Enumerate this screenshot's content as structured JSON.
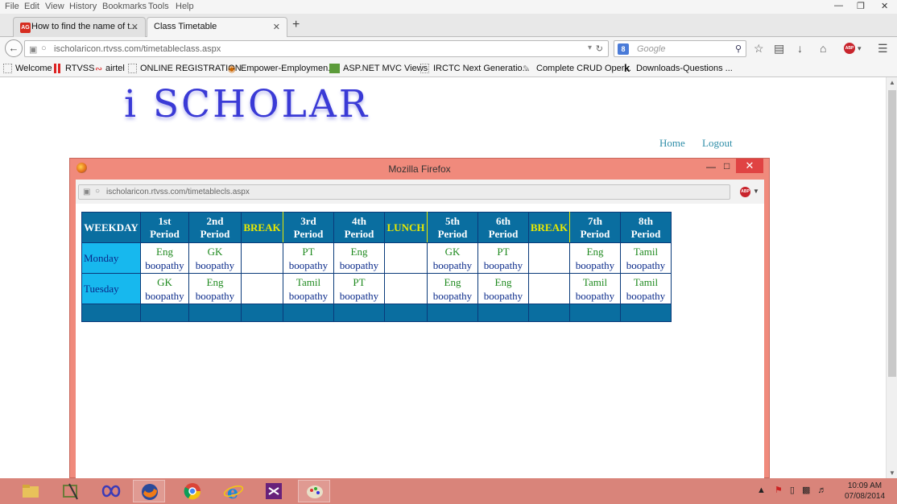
{
  "browser": {
    "menu": [
      "File",
      "Edit",
      "View",
      "History",
      "Bookmarks",
      "Tools",
      "Help"
    ],
    "tabs": [
      {
        "label": "How to find the name of t...",
        "favicon": "AG",
        "active": false
      },
      {
        "label": "Class Timetable",
        "active": true
      }
    ],
    "url": "ischolaricon.rtvss.com/timetableclass.aspx",
    "search_placeholder": "Google",
    "bookmarks": [
      "Welcome",
      "RTVSS",
      "airtel",
      "ONLINE REGISTRATION",
      "Empower-Employmen...",
      "ASP.NET MVC Views",
      "IRCTC Next Generatio...",
      "Complete CRUD Oper...",
      "Downloads-Questions ..."
    ]
  },
  "site": {
    "logo": "i SCHOLAR",
    "nav": {
      "home": "Home",
      "logout": "Logout"
    }
  },
  "popup": {
    "title": "Mozilla Firefox",
    "url": "ischolaricon.rtvss.com/timetablecls.aspx"
  },
  "timetable": {
    "headers": [
      {
        "line1": "WEEKDAY",
        "line2": "",
        "break": false
      },
      {
        "line1": "1st",
        "line2": "Period",
        "break": false
      },
      {
        "line1": "2nd",
        "line2": "Period",
        "break": false
      },
      {
        "line1": "BREAK",
        "line2": "",
        "break": true
      },
      {
        "line1": "3rd",
        "line2": "Period",
        "break": false
      },
      {
        "line1": "4th",
        "line2": "Period",
        "break": false
      },
      {
        "line1": "LUNCH",
        "line2": "",
        "break": true
      },
      {
        "line1": "5th",
        "line2": "Period",
        "break": false
      },
      {
        "line1": "6th",
        "line2": "Period",
        "break": false
      },
      {
        "line1": "BREAK",
        "line2": "",
        "break": true
      },
      {
        "line1": "7th",
        "line2": "Period",
        "break": false
      },
      {
        "line1": "8th",
        "line2": "Period",
        "break": false
      }
    ],
    "rows": [
      {
        "day": "Monday",
        "cells": [
          {
            "subject": "Eng",
            "teacher": "boopathy"
          },
          {
            "subject": "GK",
            "teacher": "boopathy"
          },
          {
            "subject": "",
            "teacher": ""
          },
          {
            "subject": "PT",
            "teacher": "boopathy"
          },
          {
            "subject": "Eng",
            "teacher": "boopathy"
          },
          {
            "subject": "",
            "teacher": ""
          },
          {
            "subject": "GK",
            "teacher": "boopathy"
          },
          {
            "subject": "PT",
            "teacher": "boopathy"
          },
          {
            "subject": "",
            "teacher": ""
          },
          {
            "subject": "Eng",
            "teacher": "boopathy"
          },
          {
            "subject": "Tamil",
            "teacher": "boopathy"
          }
        ]
      },
      {
        "day": "Tuesday",
        "cells": [
          {
            "subject": "GK",
            "teacher": "boopathy"
          },
          {
            "subject": "Eng",
            "teacher": "boopathy"
          },
          {
            "subject": "",
            "teacher": ""
          },
          {
            "subject": "Tamil",
            "teacher": "boopathy"
          },
          {
            "subject": "PT",
            "teacher": "boopathy"
          },
          {
            "subject": "",
            "teacher": ""
          },
          {
            "subject": "Eng",
            "teacher": "boopathy"
          },
          {
            "subject": "Eng",
            "teacher": "boopathy"
          },
          {
            "subject": "",
            "teacher": ""
          },
          {
            "subject": "Tamil",
            "teacher": "boopathy"
          },
          {
            "subject": "Tamil",
            "teacher": "boopathy"
          }
        ]
      }
    ]
  },
  "taskbar": {
    "apps": [
      "file-explorer-icon",
      "snipping-tool-icon",
      "visual-studio-infinity-icon",
      "firefox-icon",
      "chrome-icon",
      "internet-explorer-icon",
      "visual-studio-icon",
      "paint-icon"
    ],
    "time": "10:09 AM",
    "date": "07/08/2014"
  },
  "colors": {
    "header_bg": "#0a6ea0",
    "day_bg": "#17b8ee",
    "break_text": "#e8e800",
    "subject_text": "#1f8a1f",
    "teacher_text": "#0a2a8a",
    "popup_frame": "#f08a7c",
    "taskbar": "#d9847a"
  }
}
